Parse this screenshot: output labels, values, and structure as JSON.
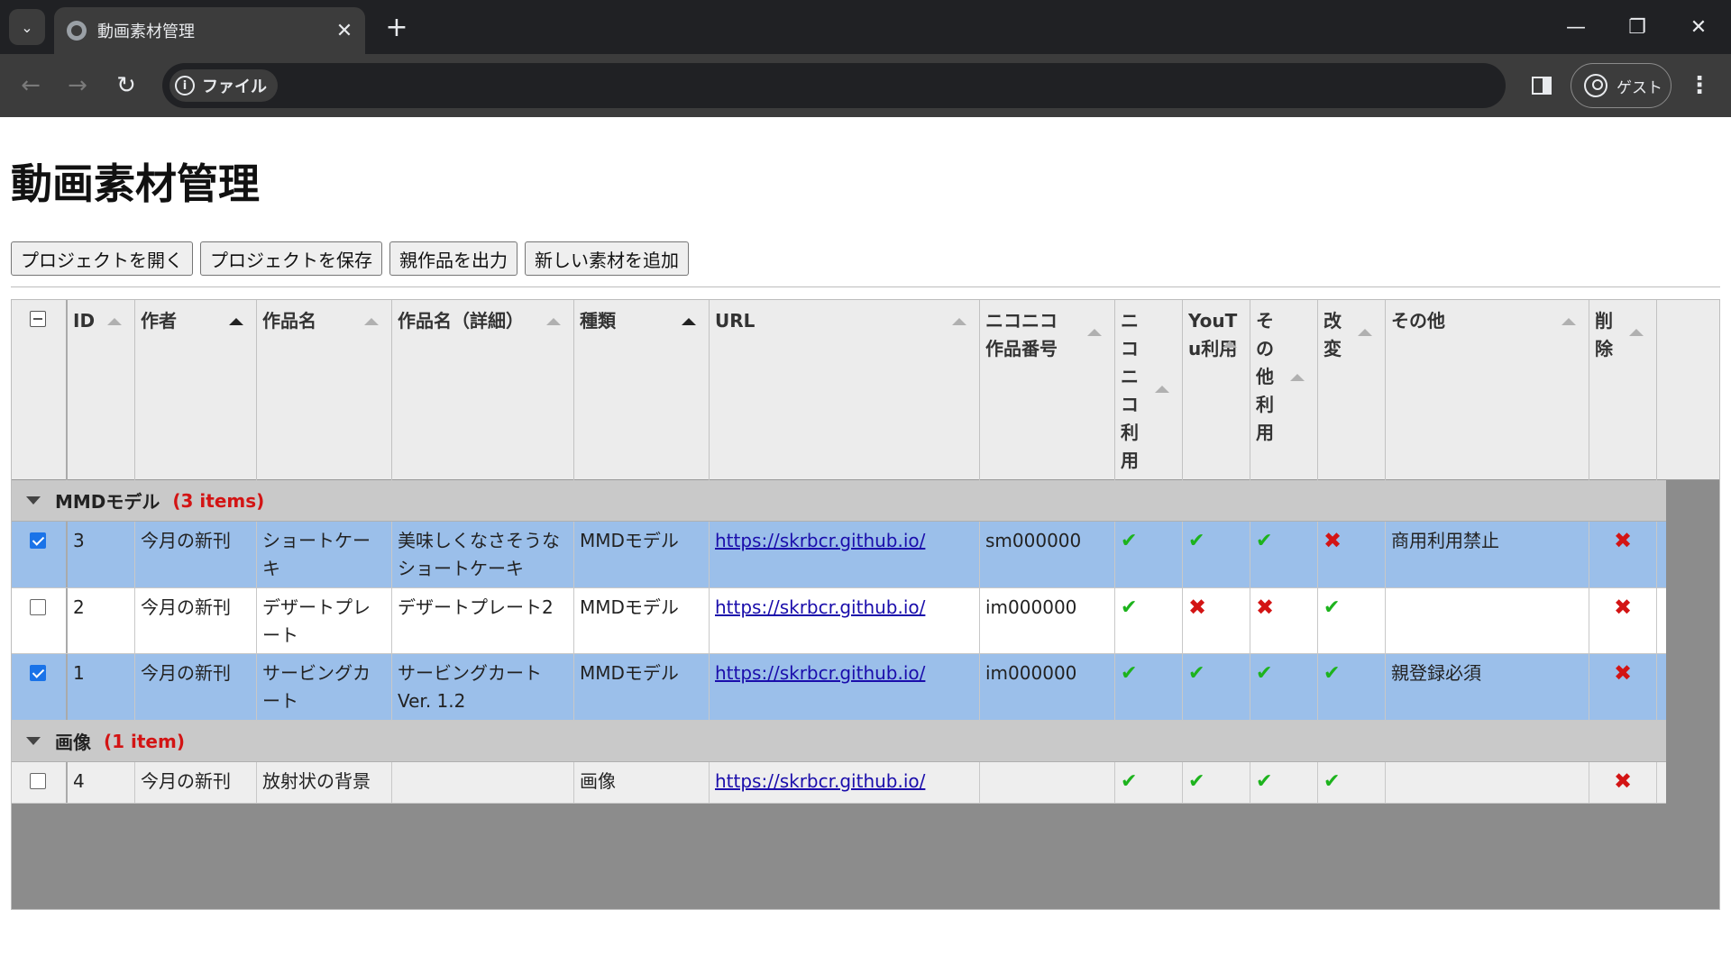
{
  "browser": {
    "tab_title": "動画素材管理",
    "address_chip": "ファイル",
    "profile_label": "ゲスト"
  },
  "page": {
    "title": "動画素材管理",
    "buttons": [
      "プロジェクトを開く",
      "プロジェクトを保存",
      "親作品を出力",
      "新しい素材を追加"
    ]
  },
  "table": {
    "columns": {
      "id": "ID",
      "author": "作者",
      "work": "作品名",
      "work_detail": "作品名（詳細）",
      "kind": "種類",
      "url": "URL",
      "nico_id": "ニコニコ作品番号",
      "nico_use": "ニコニコ利用",
      "yt_use": "YouTu利用",
      "other_use": "その他利用",
      "modify": "改変",
      "other": "その他",
      "delete": "削除"
    },
    "groups": [
      {
        "name": "MMDモデル",
        "count": "(3 items)",
        "rows": [
          {
            "checked": true,
            "id": "3",
            "author": "今月の新刊",
            "work": "ショートケーキ",
            "work_detail": "美味しくなさそうなショートケーキ",
            "kind": "MMDモデル",
            "url": "https://skrbcr.github.io/",
            "nico_id": "sm000000",
            "nico_use": "✔",
            "yt_use": "✔",
            "other_use": "✔",
            "modify": "✖",
            "other": "商用利用禁止",
            "delete": "✖"
          },
          {
            "checked": false,
            "id": "2",
            "author": "今月の新刊",
            "work": "デザートプレート",
            "work_detail": "デザートプレート2",
            "kind": "MMDモデル",
            "url": "https://skrbcr.github.io/",
            "nico_id": "im000000",
            "nico_use": "✔",
            "yt_use": "✖",
            "other_use": "✖",
            "modify": "✔",
            "other": "",
            "delete": "✖"
          },
          {
            "checked": true,
            "id": "1",
            "author": "今月の新刊",
            "work": "サービングカート",
            "work_detail": "サービングカート Ver. 1.2",
            "kind": "MMDモデル",
            "url": "https://skrbcr.github.io/",
            "nico_id": "im000000",
            "nico_use": "✔",
            "yt_use": "✔",
            "other_use": "✔",
            "modify": "✔",
            "other": "親登録必須",
            "delete": "✖"
          }
        ]
      },
      {
        "name": "画像",
        "count": "(1 item)",
        "rows": [
          {
            "checked": false,
            "id": "4",
            "author": "今月の新刊",
            "work": "放射状の背景",
            "work_detail": "",
            "kind": "画像",
            "url": "https://skrbcr.github.io/",
            "nico_id": "",
            "nico_use": "✔",
            "yt_use": "✔",
            "other_use": "✔",
            "modify": "✔",
            "other": "",
            "delete": "✖"
          }
        ]
      }
    ]
  }
}
